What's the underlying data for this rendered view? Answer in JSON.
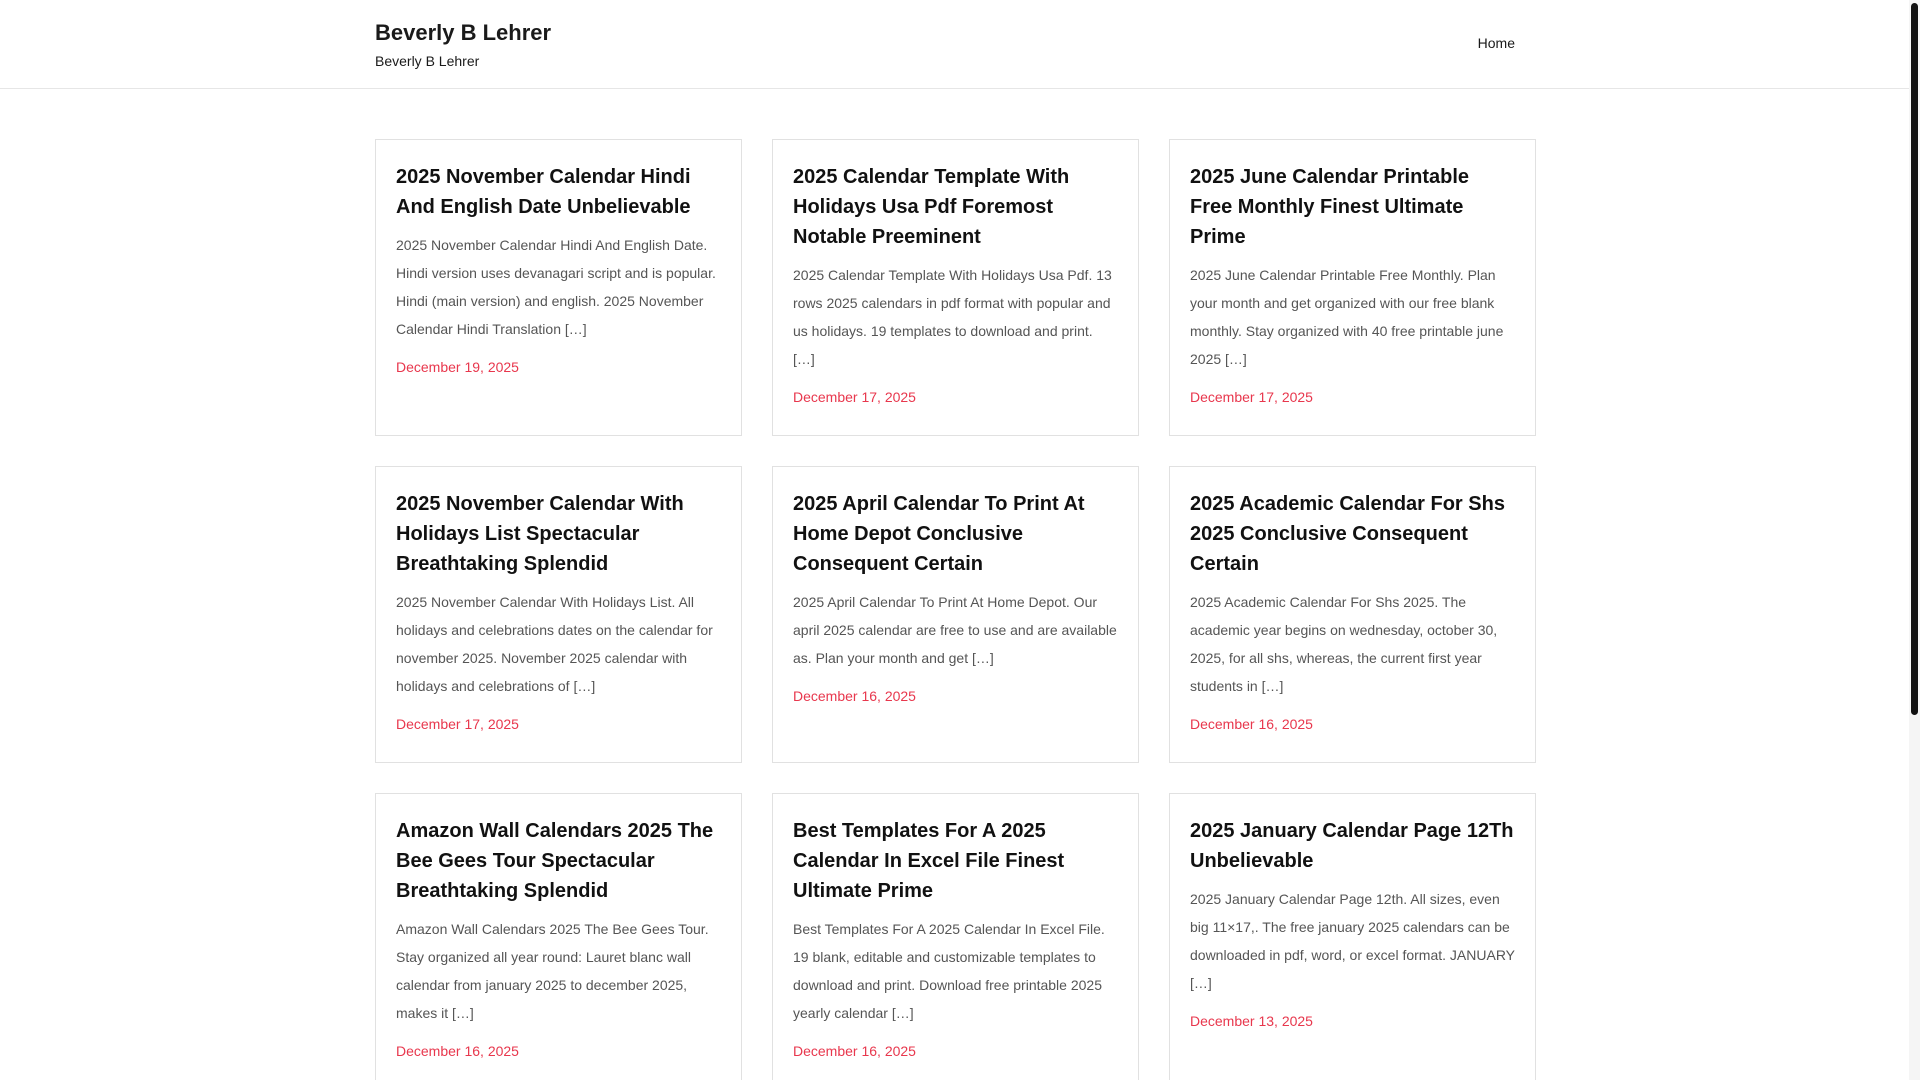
{
  "site": {
    "title": "Beverly B Lehrer",
    "tagline": "Beverly B Lehrer"
  },
  "nav": {
    "items": [
      {
        "label": "Home"
      }
    ]
  },
  "colors": {
    "accent_date": "#e8374d",
    "title_text": "#111111",
    "body_text": "#555555",
    "card_border": "#e1e1e1"
  },
  "posts": [
    {
      "title": "2025 November Calendar Hindi And English Date Unbelievable",
      "excerpt": "2025 November Calendar Hindi And English Date. Hindi version uses devanagari script and is popular. Hindi (main version) and english. 2025 November Calendar Hindi Translation […]",
      "date": "December 19, 2025"
    },
    {
      "title": "2025 Calendar Template With Holidays Usa Pdf Foremost Notable Preeminent",
      "excerpt": "2025 Calendar Template With Holidays Usa Pdf. 13 rows 2025 calendars in pdf format with popular and us holidays. 19 templates to download and print. […]",
      "date": "December 17, 2025"
    },
    {
      "title": "2025 June Calendar Printable Free Monthly Finest Ultimate Prime",
      "excerpt": "2025 June Calendar Printable Free Monthly. Plan your month and get organized with our free blank monthly. Stay organized with 40 free printable june 2025 […]",
      "date": "December 17, 2025"
    },
    {
      "title": "2025 November Calendar With Holidays List Spectacular Breathtaking Splendid",
      "excerpt": "2025 November Calendar With Holidays List. All holidays and celebrations dates on the calendar for november 2025. November 2025 calendar with holidays and celebrations of […]",
      "date": "December 17, 2025"
    },
    {
      "title": "2025 April Calendar To Print At Home Depot Conclusive Consequent Certain",
      "excerpt": "2025 April Calendar To Print At Home Depot. Our april 2025 calendar are free to use and are available as. Plan your month and get […]",
      "date": "December 16, 2025"
    },
    {
      "title": "2025 Academic Calendar For Shs 2025 Conclusive Consequent Certain",
      "excerpt": "2025 Academic Calendar For Shs 2025. The academic year begins on wednesday, october 30, 2025, for all shs, whereas, the current first year students in […]",
      "date": "December 16, 2025"
    },
    {
      "title": "Amazon Wall Calendars 2025 The Bee Gees Tour Spectacular Breathtaking Splendid",
      "excerpt": "Amazon Wall Calendars 2025 The Bee Gees Tour. Stay organized all year round: Lauret blanc wall calendar from january 2025 to december 2025, makes it […]",
      "date": "December 16, 2025"
    },
    {
      "title": "Best Templates For A 2025 Calendar In Excel File Finest Ultimate Prime",
      "excerpt": "Best Templates For A 2025 Calendar In Excel File. 19 blank, editable and customizable templates to download and print. Download free printable 2025 yearly calendar […]",
      "date": "December 16, 2025"
    },
    {
      "title": "2025 January Calendar Page 12Th Unbelievable",
      "excerpt": "2025 January Calendar Page 12th. All sizes, even big 11×17,. The free january 2025 calendars can be downloaded in pdf, word, or excel format. JANUARY […]",
      "date": "December 13, 2025"
    }
  ]
}
